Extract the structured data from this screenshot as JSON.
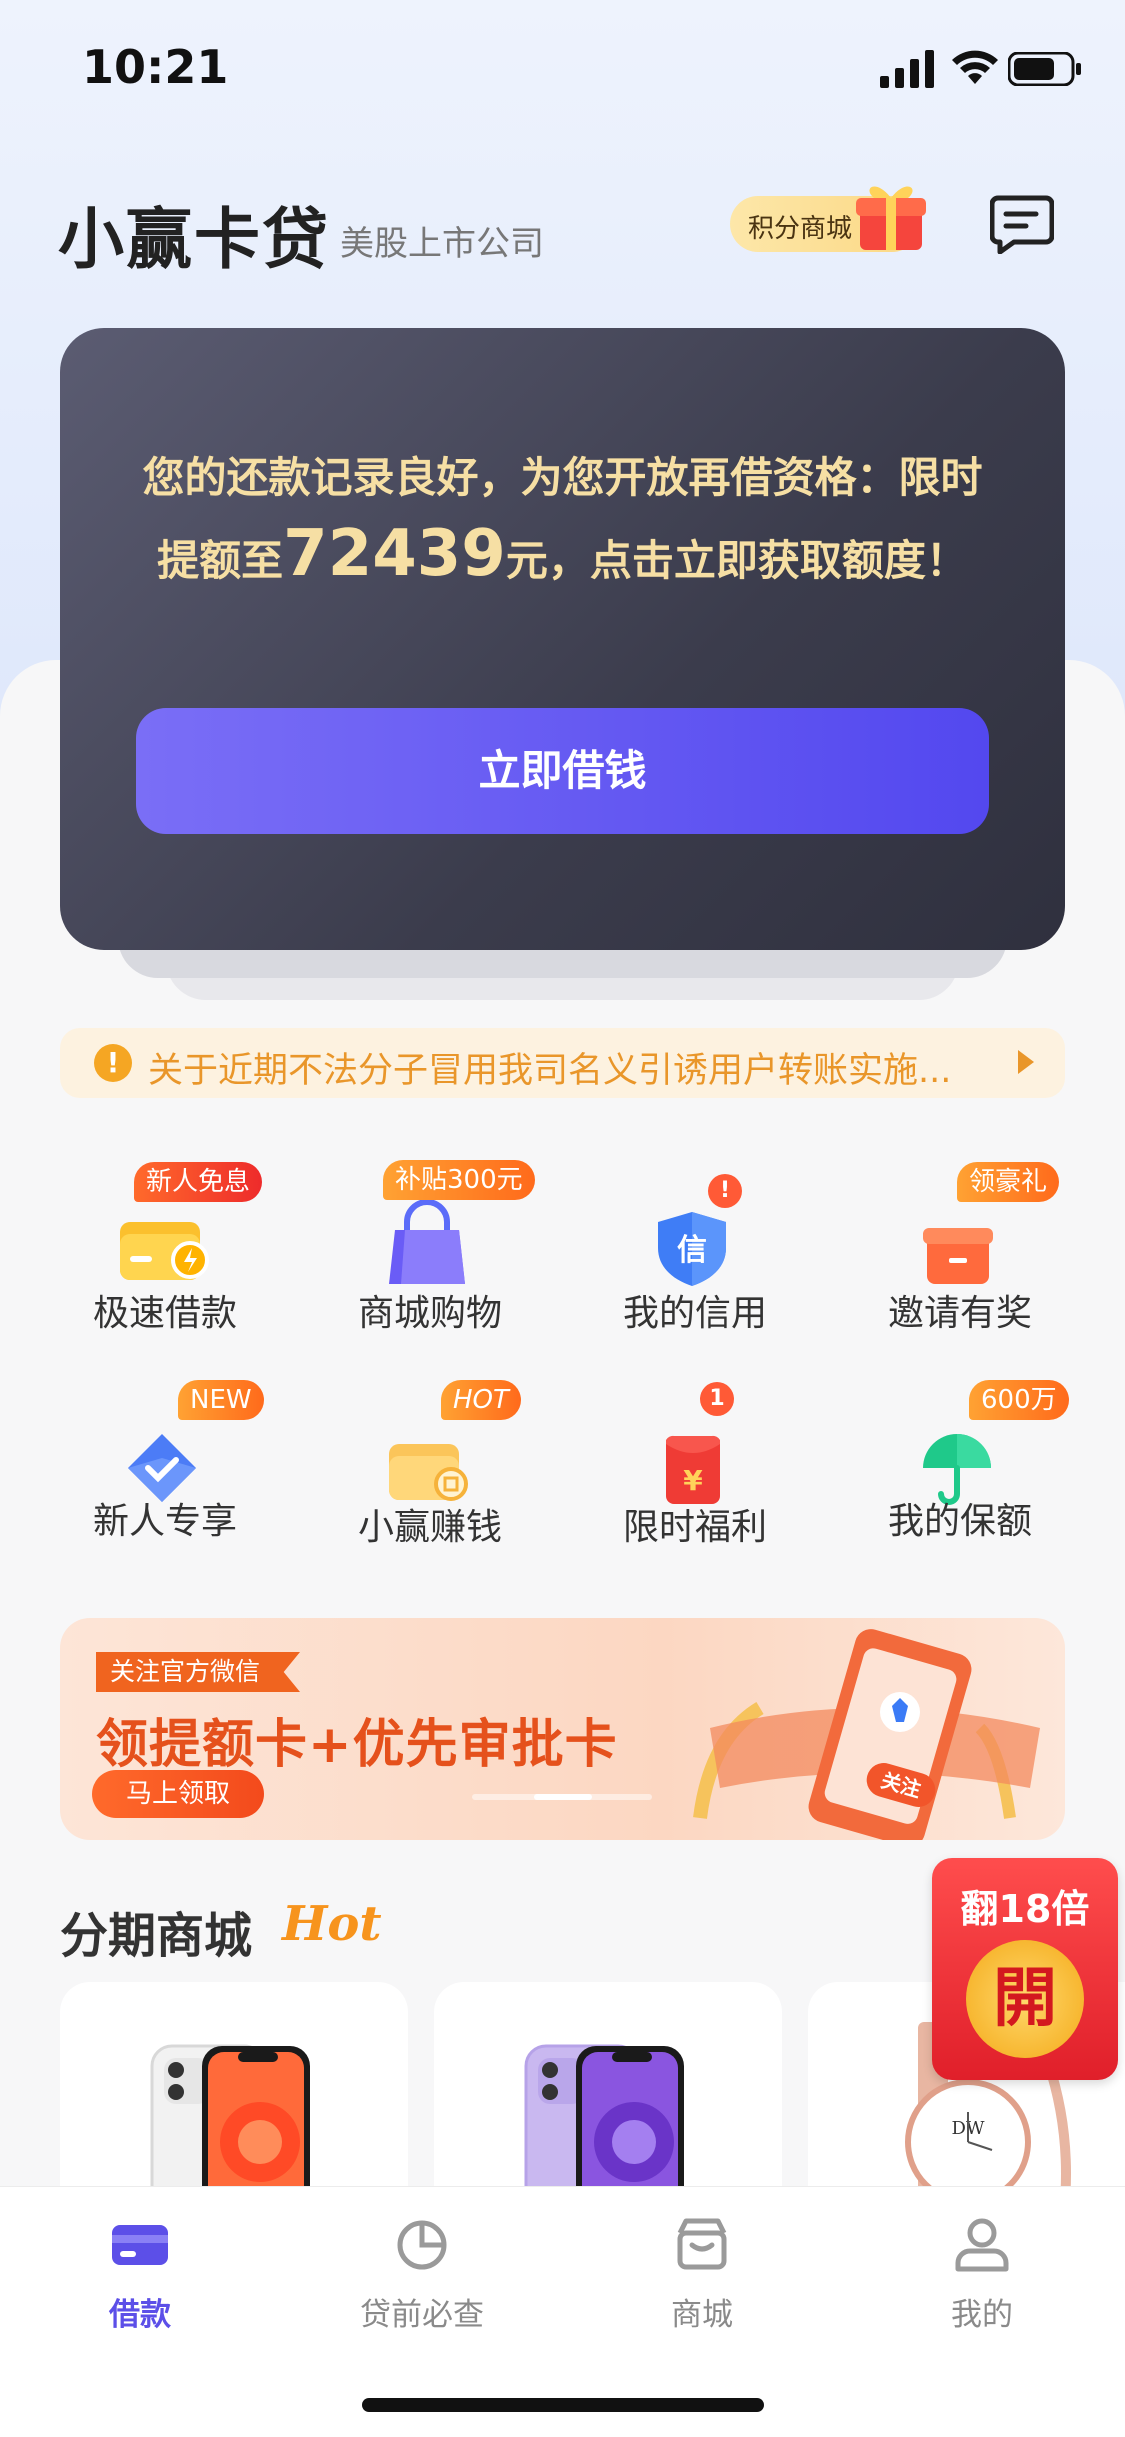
{
  "status_bar": {
    "time": "10:21"
  },
  "header": {
    "brand": "小赢卡贷",
    "subtitle": "美股上市公司",
    "points_mall": "积分商城",
    "icons": [
      "gift-icon",
      "message-icon"
    ]
  },
  "promo_card": {
    "text_before": "您的还款记录良好，为您开放再借资格：限时提额至",
    "amount": "72439",
    "text_after": "元，点击立即获取额度！",
    "button": "立即借钱"
  },
  "notice": {
    "text": "关于近期不法分子冒用我司名义引诱用户转账实施..."
  },
  "quick_menu": [
    {
      "label": "极速借款",
      "badge": "新人免息",
      "icon": "wallet-lightning-icon"
    },
    {
      "label": "商城购物",
      "badge": "补贴300元",
      "icon": "shopping-bag-icon"
    },
    {
      "label": "我的信用",
      "badge": "!",
      "icon": "shield-credit-icon",
      "icon_text": "信"
    },
    {
      "label": "邀请有奖",
      "badge": "领豪礼",
      "icon": "gift-box-icon"
    },
    {
      "label": "新人专享",
      "badge": "NEW",
      "icon": "diamond-icon"
    },
    {
      "label": "小赢赚钱",
      "badge": "HOT",
      "icon": "coin-wallet-icon"
    },
    {
      "label": "限时福利",
      "badge": "1",
      "icon": "red-packet-icon",
      "icon_text": "¥"
    },
    {
      "label": "我的保额",
      "badge": "600万",
      "icon": "umbrella-icon"
    }
  ],
  "banner": {
    "tag": "关注官方微信",
    "title": "领提额卡+优先审批卡",
    "button": "马上领取",
    "art_text": "关注"
  },
  "mall": {
    "title": "分期商城",
    "hot": "Hot"
  },
  "float_widget": {
    "title": "翻18倍",
    "coin": "開"
  },
  "tabbar": [
    {
      "label": "借款",
      "active": true,
      "icon": "card-icon"
    },
    {
      "label": "贷前必查",
      "active": false,
      "icon": "pie-chart-icon"
    },
    {
      "label": "商城",
      "active": false,
      "icon": "store-icon"
    },
    {
      "label": "我的",
      "active": false,
      "icon": "user-icon"
    }
  ],
  "colors": {
    "accent": "#5c4fe8",
    "card_bg": "#3b3c4c",
    "card_text": "#f6dfa4",
    "notice": "#e9962a",
    "badge": "#ff5a2b"
  }
}
